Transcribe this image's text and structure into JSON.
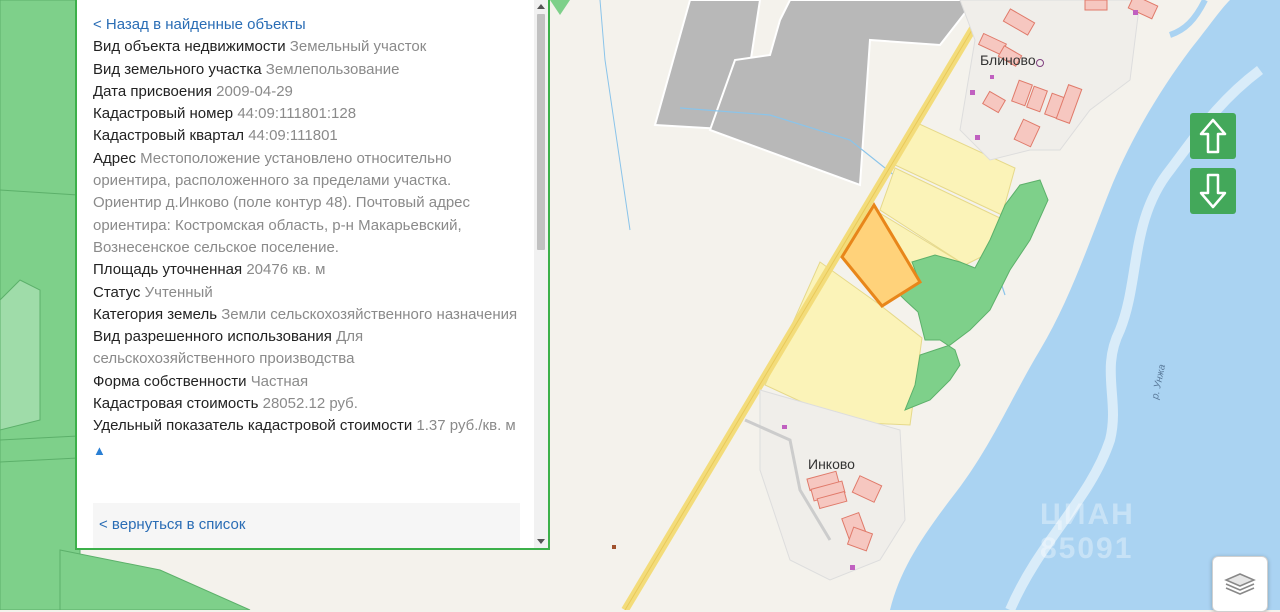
{
  "panel": {
    "back_link": "< Назад в найденные объекты",
    "fields": [
      {
        "label": "Вид объекта недвижимости",
        "value": "Земельный участок"
      },
      {
        "label": "Вид земельного участка",
        "value": "Землепользование"
      },
      {
        "label": "Дата присвоения",
        "value": "2009-04-29"
      },
      {
        "label": "Кадастровый номер",
        "value": "44:09:111801:128"
      },
      {
        "label": "Кадастровый квартал",
        "value": "44:09:111801"
      },
      {
        "label": "Адрес",
        "value": "Местоположение установлено относительно ориентира, расположенного за пределами участка. Ориентир д.Инково (поле контур 48). Почтовый адрес ориентира: Костромская область, р-н Макарьевский, Вознесенское сельское поселение."
      },
      {
        "label": "Площадь уточненная",
        "value": "20476 кв. м"
      },
      {
        "label": "Статус",
        "value": "Учтенный"
      },
      {
        "label": "Категория земель",
        "value": "Земли сельскохозяйственного назначения"
      },
      {
        "label": "Вид разрешенного использования",
        "value": "Для сельскохозяйственного производства"
      },
      {
        "label": "Форма собственности",
        "value": "Частная"
      },
      {
        "label": "Кадастровая стоимость",
        "value": "28052.12 руб."
      },
      {
        "label": "Удельный показатель кадастровой стоимости",
        "value": "1.37 руб./кв. м"
      }
    ],
    "collapse_glyph": "▲",
    "list_link": "< вернуться в список"
  },
  "map": {
    "places": [
      "Блиново",
      "Инково"
    ],
    "river": "р. Унжа",
    "watermark": "ЦИАН 85091",
    "colors": {
      "forest": "#7ed08a",
      "field": "#fbf3b8",
      "selected_parcel": "#ffd27a",
      "selected_border": "#e8861a",
      "water": "#aad3f2",
      "road": "#f3dc7a",
      "building_fill": "#f6c7c0",
      "building_border": "#e07a6a",
      "urban": "#b8b8b8"
    }
  },
  "controls": {
    "up_icon": "arrow-up-icon",
    "down_icon": "arrow-down-icon",
    "layers_icon": "layers-icon"
  }
}
